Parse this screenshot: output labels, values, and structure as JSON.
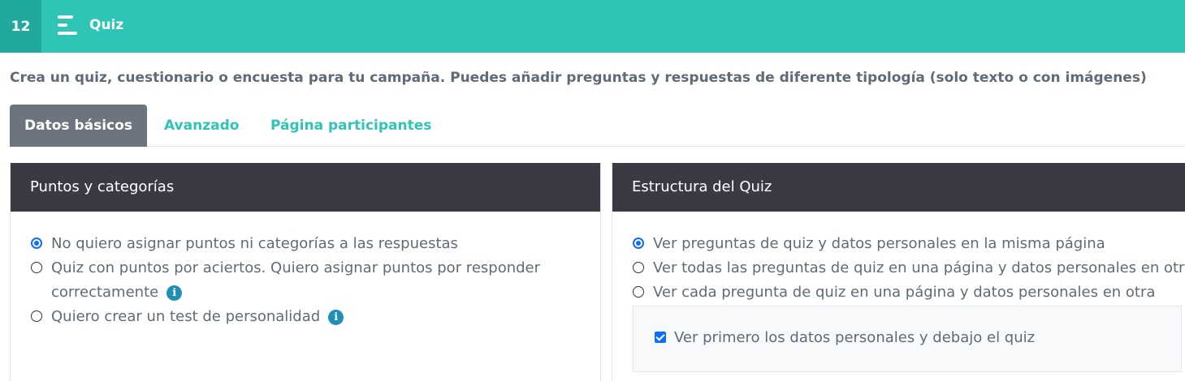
{
  "header": {
    "step_number": "12",
    "title": "Quiz"
  },
  "intro": "Crea un quiz, cuestionario o encuesta para tu campaña. Puedes añadir preguntas y respuestas de diferente tipología (solo texto o con imágenes)",
  "tabs": [
    {
      "label": "Datos básicos",
      "active": true
    },
    {
      "label": "Avanzado",
      "active": false
    },
    {
      "label": "Página participantes",
      "active": false
    }
  ],
  "points_panel": {
    "title": "Puntos y categorías",
    "options": [
      {
        "line1": "No quiero asignar puntos ni categorías a las respuestas",
        "selected": true
      },
      {
        "line1": "Quiz con puntos por aciertos. Quiero asignar puntos por responder",
        "line2": "correctamente",
        "selected": false,
        "info": true
      },
      {
        "line1": "Quiero crear un test de personalidad",
        "selected": false,
        "info": true
      }
    ]
  },
  "structure_panel": {
    "title": "Estructura del Quiz",
    "options": [
      {
        "label": "Ver preguntas de quiz y datos personales en la misma página",
        "selected": true
      },
      {
        "label": "Ver todas las preguntas de quiz en una página y datos personales en otra",
        "selected": false
      },
      {
        "label": "Ver cada pregunta de quiz en una página y datos personales en otra",
        "selected": false
      }
    ],
    "checkbox": {
      "label": "Ver primero los datos personales y debajo el quiz",
      "checked": true
    }
  },
  "colors": {
    "topbar": "#2ec4b6",
    "step_badge": "#22a99d",
    "panel_header": "#3a3a45",
    "active_tab": "#6c757d",
    "tab_link": "#2ec4b6",
    "radio_selected": "#0d6efd",
    "info_icon": "#1f8fb6"
  },
  "icons": {
    "menu": "menu-lines-icon",
    "info": "info-circle-icon"
  }
}
